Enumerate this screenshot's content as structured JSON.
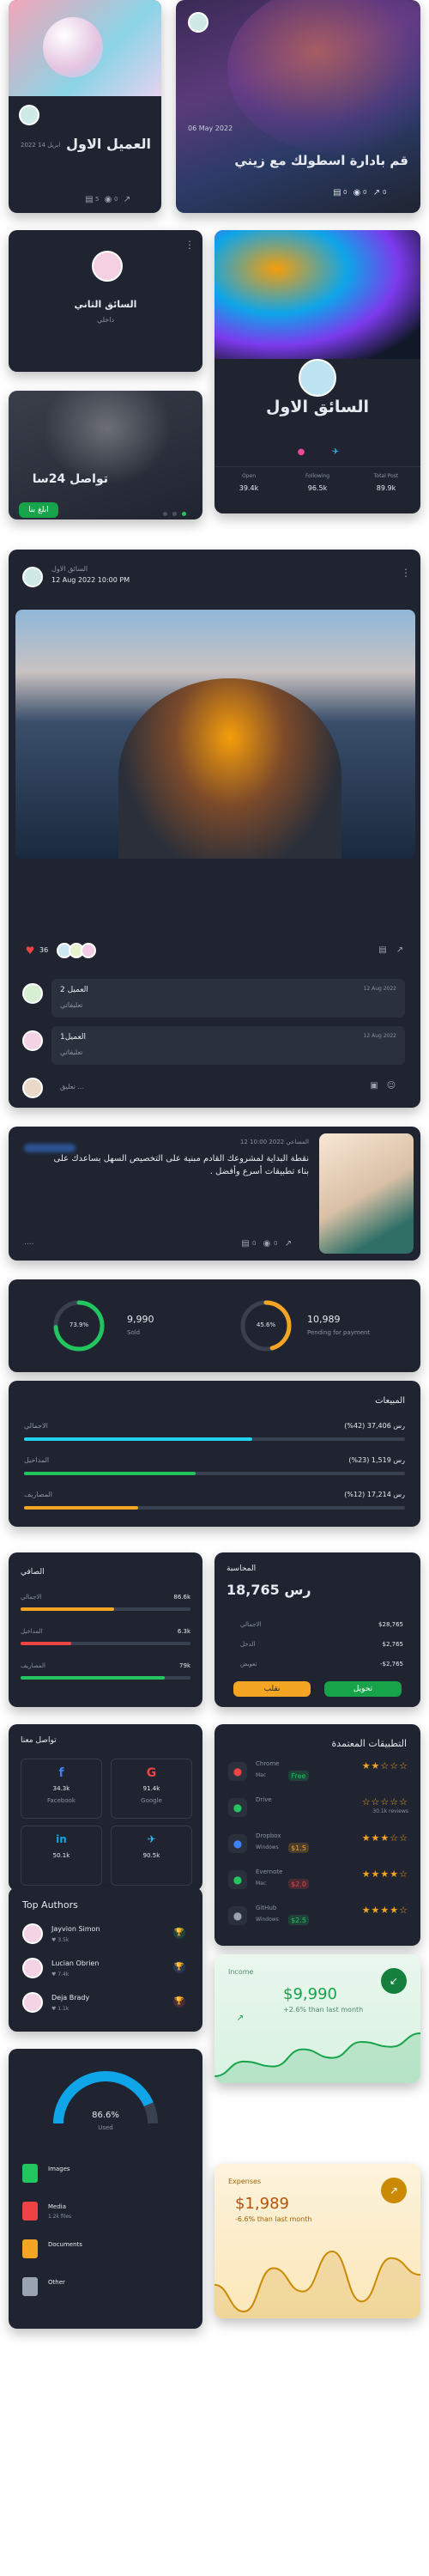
{
  "colors": {
    "card": "#1f2430",
    "green": "#22c55e",
    "orange": "#f5a524",
    "red": "#ef4444",
    "cyan": "#22d3ee",
    "blue": "#0ea5e9"
  },
  "card1": {
    "title": "العميل الاول",
    "date": "ابريل 14 2022",
    "likes": "5",
    "views": "0"
  },
  "card2": {
    "date": "06 May 2022",
    "title": "قم بادارة اسطولك مع زيني",
    "likes": "0",
    "comments": "0",
    "shares": "0"
  },
  "card3": {
    "name": "السائق الثاني",
    "sub": "داخلي"
  },
  "card4": {
    "name": "السائق الاول",
    "stat1_label": "Open",
    "stat1_value": "39.4k",
    "stat2_label": "Following",
    "stat2_value": "96.5k",
    "stat3_label": "Total Post",
    "stat3_value": "89.9k"
  },
  "card5": {
    "title": "تواصل 24سا",
    "button": "ابلغ بنا"
  },
  "post": {
    "author": "السائق الاول",
    "date": "12 Aug 2022 10:00 PM",
    "likes": "36",
    "comments": [
      {
        "name": "العميل 2",
        "time": "12 Aug 2022",
        "text": "تعليقاتي"
      },
      {
        "name": "العميل1",
        "time": "12 Aug 2022",
        "text": "تعليقاتي"
      }
    ],
    "input_placeholder": "تعليق ..."
  },
  "news": {
    "meta": "12 10:00 2022 المساعي",
    "text": "نقطة البداية لمشروعك القادم مبنية على التخصيص السهل بساعدك على بناء تطبيقات أسرع وأفضل .",
    "likes": "0",
    "comments": "0"
  },
  "stats": {
    "left_percent": "73.9%",
    "left_value": "9,990",
    "left_label": "Sold",
    "right_percent": "45.6%",
    "right_value": "10,989",
    "right_label": "Pending for payment"
  },
  "sales": {
    "title": "المبيعات",
    "rows": [
      {
        "label": "الاجمالي",
        "value": "(%42) 37,406 رس",
        "color": "#22d3ee",
        "fill": 0.6
      },
      {
        "label": "المداخيل",
        "value": "(%23) 1,519 رس",
        "color": "#22c55e",
        "fill": 0.45
      },
      {
        "label": "المصاريف",
        "value": "(%12) 17,214 رس",
        "color": "#f5a524",
        "fill": 0.3
      }
    ]
  },
  "profit": {
    "title": "الصافي",
    "rows": [
      {
        "label": "الاجمالي",
        "value": "86.6k",
        "color": "#f5a524",
        "fill": 0.55
      },
      {
        "label": "المداخيل",
        "value": "6.3k",
        "color": "#ef4444",
        "fill": 0.3
      },
      {
        "label": "المصاريف",
        "value": "79k",
        "color": "#22c55e",
        "fill": 0.85
      }
    ]
  },
  "accounting": {
    "title": "المحاسبة",
    "amount": "18,765 رس",
    "rows": [
      {
        "label": "الاجمالي",
        "value": "$28,765"
      },
      {
        "label": "الدخل",
        "value": "$2,765"
      },
      {
        "label": "تعويض",
        "value": "-$2,765"
      }
    ],
    "btn_left": "نقلب",
    "btn_right": "تحويل"
  },
  "social": {
    "title": "تواصل معنا",
    "items": [
      {
        "name": "Facebook",
        "count": "34.3k",
        "icon": "f",
        "color": "#3b82f6"
      },
      {
        "name": "Google",
        "count": "91.4k",
        "icon": "G",
        "color": "#ef4444"
      },
      {
        "name": "",
        "count": "50.1k",
        "icon": "in",
        "color": "#0ea5e9"
      },
      {
        "name": "",
        "count": "90.5k",
        "icon": "✈",
        "color": "#38bdf8"
      }
    ]
  },
  "apps": {
    "title": "التطبيقات المعتمدة",
    "items": [
      {
        "name": "Chrome",
        "sub": "Mac",
        "tag": "Free",
        "tag_color": "#22c55e",
        "stars": 2,
        "reviews": "",
        "icon_color": "#ef4444"
      },
      {
        "name": "Drive",
        "sub": "",
        "tag": "",
        "tag_color": "",
        "stars": 0,
        "reviews": "30.1k reviews",
        "icon_color": "#22c55e"
      },
      {
        "name": "Dropbox",
        "sub": "Windows",
        "tag": "$1.5",
        "tag_color": "#f5a524",
        "stars": 3,
        "reviews": "",
        "icon_color": "#3b82f6"
      },
      {
        "name": "Evernote",
        "sub": "Mac",
        "tag": "$2.0",
        "tag_color": "#ef4444",
        "stars": 4,
        "reviews": "",
        "icon_color": "#22c55e"
      },
      {
        "name": "GitHub",
        "sub": "Windows",
        "tag": "$2.5",
        "tag_color": "#22c55e",
        "stars": 4,
        "reviews": "",
        "icon_color": "#9aa3b2"
      }
    ]
  },
  "authors": {
    "title": "Top Authors",
    "items": [
      {
        "name": "Jayvion Simon",
        "count": "3.5k",
        "trophy": "#22c55e"
      },
      {
        "name": "Lucian Obrien",
        "count": "7.4k",
        "trophy": "#3b82f6"
      },
      {
        "name": "Deja Brady",
        "count": "1.1k",
        "trophy": "#ef4444"
      }
    ]
  },
  "income": {
    "label": "Income",
    "amount": "$9,990",
    "change": "+2.6% than last month"
  },
  "storage": {
    "percent": "86.6%",
    "sub": "Used",
    "files": [
      {
        "name": "Images",
        "size": "",
        "color": "#22c55e"
      },
      {
        "name": "Media",
        "size": "1.2k files",
        "color": "#ef4444"
      },
      {
        "name": "Documents",
        "size": "",
        "color": "#f5a524"
      },
      {
        "name": "Other",
        "size": "",
        "color": "#9aa3b2"
      }
    ]
  },
  "expenses": {
    "label": "Expenses",
    "amount": "$1,989",
    "change": "-6.6% than last month"
  },
  "chart_data": [
    {
      "type": "area",
      "title": "Income",
      "x": [
        1,
        2,
        3,
        4,
        5,
        6,
        7,
        8
      ],
      "y": [
        20,
        32,
        28,
        42,
        35,
        48,
        44,
        55
      ]
    },
    {
      "type": "area",
      "title": "Expenses",
      "x": [
        1,
        2,
        3,
        4,
        5,
        6,
        7,
        8
      ],
      "y": [
        30,
        22,
        35,
        28,
        40,
        25,
        38,
        33
      ]
    }
  ]
}
